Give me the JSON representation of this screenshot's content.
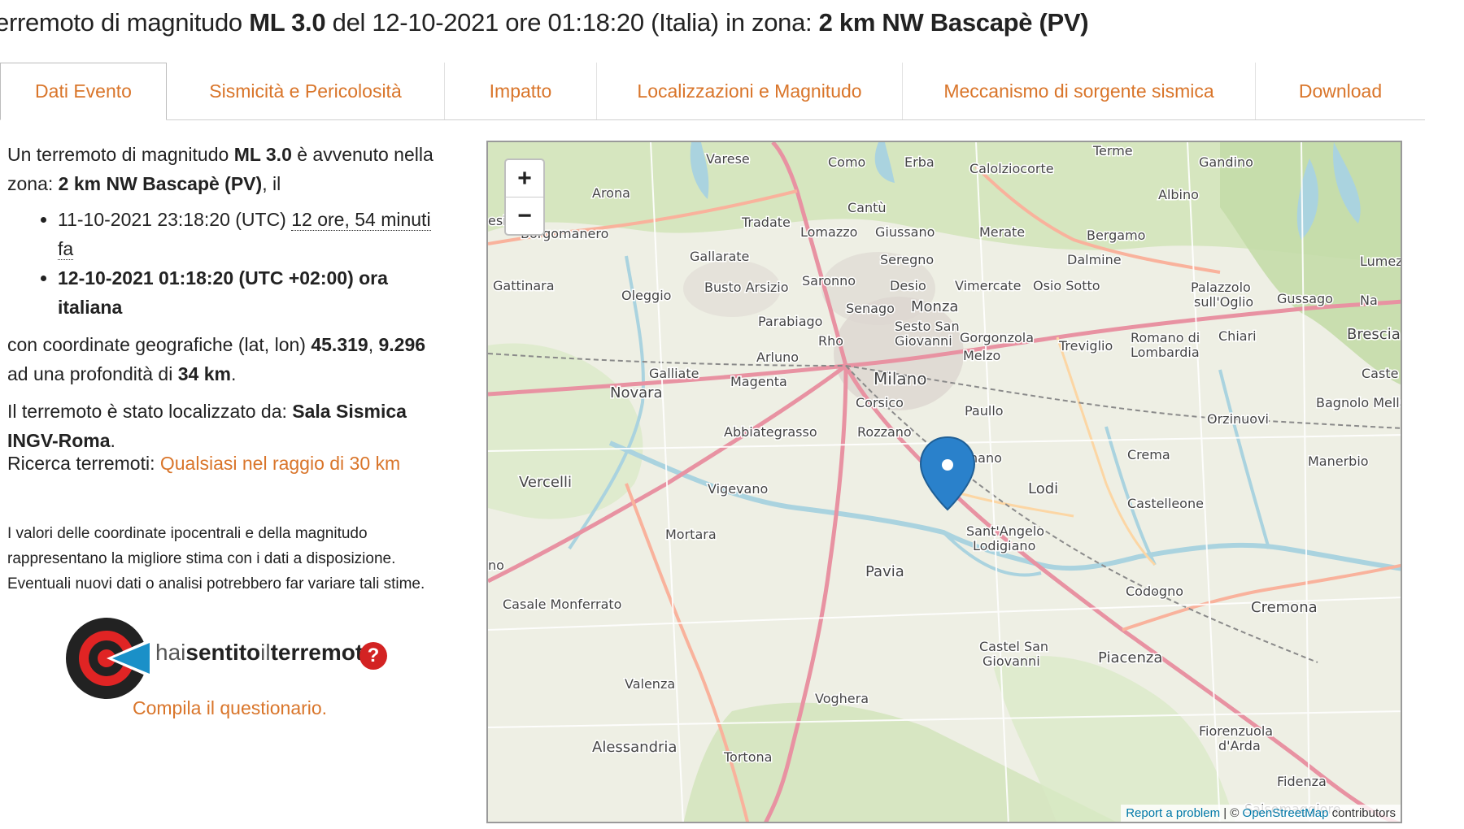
{
  "title": {
    "prefix": "erremoto di magnitudo",
    "magnitude": "ML 3.0",
    "middle": "del 12-10-2021 ore 01:18:20 (Italia) in zona:",
    "zone": "2 km NW Bascapè (PV)"
  },
  "tabs": [
    {
      "label": "Dati Evento",
      "active": true
    },
    {
      "label": "Sismicità e Pericolosità",
      "active": false
    },
    {
      "label": "Impatto",
      "active": false
    },
    {
      "label": "Localizzazioni e Magnitudo",
      "active": false
    },
    {
      "label": "Meccanismo di sorgente sismica",
      "active": false
    },
    {
      "label": "Download",
      "active": false
    }
  ],
  "event": {
    "intro_1": "Un terremoto di magnitudo",
    "magnitude": "ML 3.0",
    "intro_2": "è avvenuto nella zona:",
    "zone": "2 km NW Bascapè (PV)",
    "intro_3": ", il",
    "utc_time": "11-10-2021 23:18:20 (UTC)",
    "ago": "12 ore, 54 minuti fa",
    "local_time": "12-10-2021 01:18:20 (UTC +02:00) ora italiana",
    "coords_text": "con coordinate geografiche (lat, lon)",
    "lat": "45.319",
    "lon": "9.296",
    "depth_text_1": "ad una profondità di",
    "depth": "34 km",
    "located_text": "Il terremoto è stato localizzato da:",
    "located_by": "Sala Sismica INGV-Roma"
  },
  "search": {
    "label": "Ricerca terremoti:",
    "link": "Qualsiasi nel raggio di 30 km"
  },
  "disclaimer": "I valori delle coordinate ipocentrali e della magnitudo rappresentano la migliore stima con i dati a disposizione. Eventuali nuovi dati o analisi potrebbero far variare tali stime.",
  "hst": {
    "hai": "hai",
    "sentito": "sentito",
    "il": "il",
    "terremoto": "terremoto",
    "q": "?",
    "compile": "Compila il questionario."
  },
  "map": {
    "zoom_in": "+",
    "zoom_out": "−",
    "attribution_report": "Report a problem",
    "attribution_sep": " | © ",
    "attribution_osm": "OpenStreetMap",
    "attribution_tail": " contributors",
    "places": [
      "Varese",
      "Como",
      "Erba",
      "Calolziocorte",
      "Terme",
      "Gandino",
      "Albino",
      "Arona",
      "Cantù",
      "Tradate",
      "Lomazzo",
      "Giussano",
      "Merate",
      "Bergamo",
      "Borgomanero",
      "Gallarate",
      "Seregno",
      "Dalmine",
      "Lumezz",
      "Gattinara",
      "Oleggio",
      "Busto Arsizio",
      "Saronno",
      "Desio",
      "Vimercate",
      "Osio Sotto",
      "Palazzolo sull'Oglio",
      "Gussago",
      "Monza",
      "Senago",
      "Parabiago",
      "Sesto San Giovanni",
      "Gorgonzola",
      "Treviglio",
      "Romano di Lombardia",
      "Chiari",
      "Brescia",
      "Rho",
      "Melzo",
      "Arluno",
      "Galliate",
      "Milano",
      "Magenta",
      "Novara",
      "Corsico",
      "Paullo",
      "Bagnolo Mella",
      "Orzinuovi",
      "Abbiategrasso",
      "Rozzano",
      "Crema",
      "Manerbio",
      "Melegnano",
      "Lodi",
      "Vercelli",
      "Vigevano",
      "Castelleone",
      "Mortara",
      "Sant'Angelo Lodigiano",
      "Pavia",
      "Codogno",
      "Casale Monferrato",
      "Cremona",
      "Castel San Giovanni",
      "Piacenza",
      "Valenza",
      "Voghera",
      "Alessandria",
      "Tortona",
      "Fiorenzuola d'Arda",
      "Fidenza",
      "Salsomaggiore"
    ]
  }
}
